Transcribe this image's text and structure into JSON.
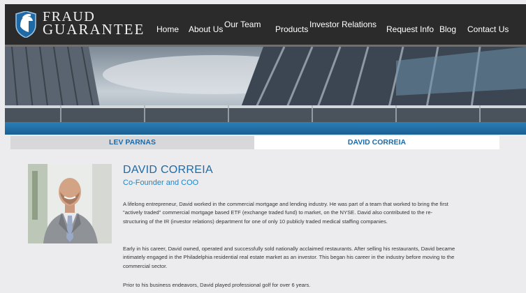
{
  "brand": {
    "line1": "FRAUD",
    "line2": "GUARANTEE"
  },
  "nav": {
    "home": "Home",
    "about": "About Us",
    "team": "Our Team",
    "products": "Products",
    "investor": "Investor Relations",
    "request": "Request Info",
    "blog": "Blog",
    "contact": "Contact Us"
  },
  "tabs": {
    "lev": "LEV PARNAS",
    "david": "DAVID CORREIA",
    "active": "david"
  },
  "profile": {
    "name": "DAVID CORREIA",
    "title": "Co-Founder and COO",
    "paragraphs": [
      "A lifelong entrepreneur, David worked in the commercial mortgage and lending industry. He was part of a team that worked to bring the first \"actively traded\" commercial mortgage based ETF (exchange traded fund) to market, on the NYSE. David also contributed to the re-structuring of the IR (investor relations) department for one of only 10 publicly traded medical staffing companies.",
      "Early in his career, David owned, operated and successfully sold nationally acclaimed restaurants. After selling his restaurants, David became intimately engaged in the Philadelphia residential real estate market as an investor. This began his career in the industry before moving to the commercial sector.",
      "Prior to his business endeavors, David played professional golf for over 6 years."
    ]
  },
  "colors": {
    "header_bg": "#2c2b2c",
    "accent_blue": "#1f6aa5",
    "blue_bar": "#1b5f93",
    "page_bg": "#ececee"
  }
}
